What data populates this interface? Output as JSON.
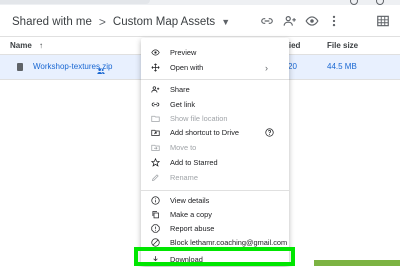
{
  "breadcrumb": {
    "root": "Shared with me",
    "separator": ">",
    "folder": "Custom Map Assets"
  },
  "columns": {
    "name": "Name",
    "sort_arrow": "↑",
    "modified": "ified",
    "size": "File size"
  },
  "file": {
    "name": "Workshop-textures.zip",
    "modified": "20",
    "size": "44.5 MB"
  },
  "menu": [
    {
      "label": "Preview",
      "icon": "eye-icon",
      "disabled": false
    },
    {
      "label": "Open with",
      "icon": "move-arrows-icon",
      "disabled": false,
      "submenu": true
    },
    {
      "label": "Share",
      "icon": "share-person-icon",
      "disabled": false
    },
    {
      "label": "Get link",
      "icon": "link-icon",
      "disabled": false
    },
    {
      "label": "Show file location",
      "icon": "folder-icon",
      "disabled": true
    },
    {
      "label": "Add shortcut to Drive",
      "icon": "shortcut-icon",
      "disabled": false,
      "help": true
    },
    {
      "label": "Move to",
      "icon": "move-folder-icon",
      "disabled": true
    },
    {
      "label": "Add to Starred",
      "icon": "star-icon",
      "disabled": false
    },
    {
      "label": "Rename",
      "icon": "pencil-icon",
      "disabled": true
    },
    {
      "label": "View details",
      "icon": "info-icon",
      "disabled": false
    },
    {
      "label": "Make a copy",
      "icon": "copy-icon",
      "disabled": false
    },
    {
      "label": "Report abuse",
      "icon": "report-icon",
      "disabled": false
    },
    {
      "label": "Block lethamr.coaching@gmail.com",
      "icon": "block-icon",
      "disabled": false
    },
    {
      "label": "Download",
      "icon": "download-icon",
      "disabled": false
    }
  ],
  "colors": {
    "selection": "#e8f0fe",
    "link_blue": "#1967d2",
    "highlight_green": "#00e600"
  }
}
